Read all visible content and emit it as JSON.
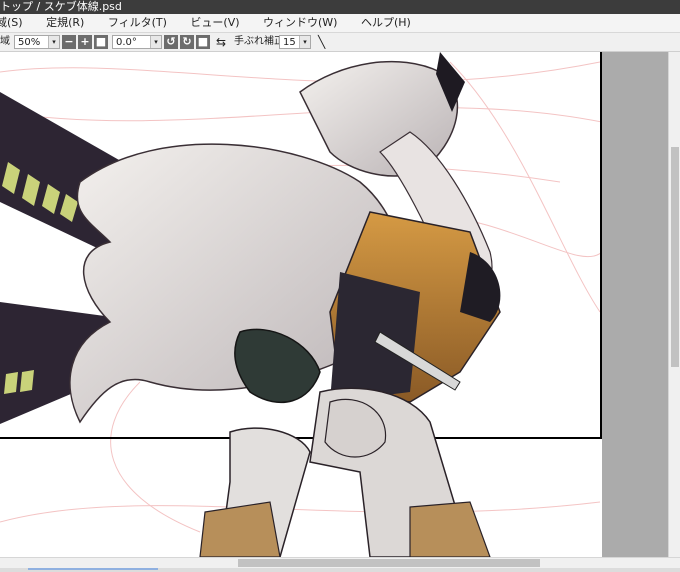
{
  "window": {
    "title": "トップ / スケブ体線.psd"
  },
  "menu": {
    "items": [
      "域(S)",
      "定規(R)",
      "フィルタ(T)",
      "ビュー(V)",
      "ウィンドウ(W)",
      "ヘルプ(H)"
    ]
  },
  "toolbar": {
    "zoom_label": "域",
    "zoom_value": "50%",
    "angle_value": "0.0°",
    "stabilizer_label": "手ぶれ補正",
    "stabilizer_value": "15"
  },
  "icons": {
    "zoom_out": "minus-icon",
    "zoom_in": "plus-icon",
    "fit": "square-icon",
    "rotate_left": "rotate-left-icon",
    "rotate_right": "rotate-right-icon",
    "reset": "reset-icon",
    "flip": "flip-horizontal-icon",
    "pen": "line-tool-icon"
  },
  "colors": {
    "titlebar": "#3c3c3c",
    "outside_canvas": "#ababab",
    "canvas": "#ffffff"
  }
}
